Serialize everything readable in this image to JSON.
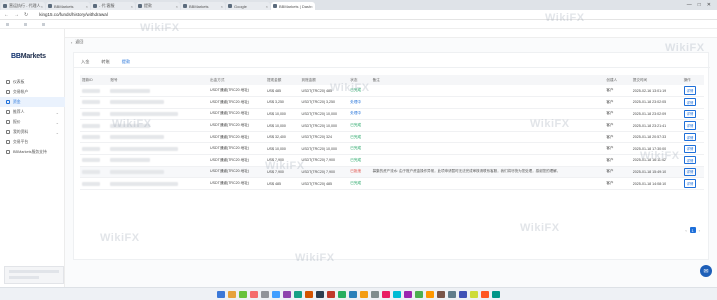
{
  "browser": {
    "tabs": [
      {
        "label": "营运执行 - 代理人"
      },
      {
        "label": "BBMarkets"
      },
      {
        "label": "- 代 客服"
      },
      {
        "label": "提款"
      },
      {
        "label": "BBMarkets"
      },
      {
        "label": "Google"
      },
      {
        "label": "BBMarkets | Dashboard"
      }
    ],
    "url": "king15.co/funds/history/withdrawal"
  },
  "sidebar": {
    "logo_prefix": "BB",
    "logo_suffix": "Markets",
    "items": [
      {
        "label": "仪表板"
      },
      {
        "label": "交易帐户"
      },
      {
        "label": "资金"
      },
      {
        "label": "推荐人"
      },
      {
        "label": "报价"
      },
      {
        "label": "我的资料"
      },
      {
        "label": "交易平台"
      },
      {
        "label": "BBMarkets服务支持"
      }
    ]
  },
  "main": {
    "back_label": "返回",
    "tabs": [
      {
        "label": "入金"
      },
      {
        "label": "转账"
      },
      {
        "label": "提款"
      }
    ],
    "columns": [
      "提款ID",
      "账号",
      "出金方式",
      "提现金额",
      "到账金额",
      "状态",
      "备注",
      "创建人",
      "提交时间",
      "操作"
    ],
    "rows": [
      {
        "method": "USDT通道(TRC20 地址)",
        "amount": "US$ 485",
        "received": "USDT(TRC20) 485",
        "status": "已完成",
        "status_class": "ok",
        "note": "",
        "creator": "客户",
        "time": "2025-02-16 13:01:19",
        "action": "详情"
      },
      {
        "method": "USDT通道(TRC20 地址)",
        "amount": "US$ 3,250",
        "received": "USDT(TRC20) 3,250",
        "status": "处理中",
        "status_class": "proc",
        "note": "",
        "creator": "客户",
        "time": "2025-01-18 23:02:05",
        "action": "详情"
      },
      {
        "method": "USDT通道(TRC20 地址)",
        "amount": "US$ 10,000",
        "received": "USDT(TRC20) 10,000",
        "status": "处理中",
        "status_class": "proc",
        "note": "",
        "creator": "客户",
        "time": "2025-01-18 23:02:09",
        "action": "详情"
      },
      {
        "method": "USDT通道(TRC20 地址)",
        "amount": "US$ 10,000",
        "received": "USDT(TRC20) 10,000",
        "status": "已完成",
        "status_class": "ok",
        "note": "",
        "creator": "客户",
        "time": "2025-01-18 23:21:41",
        "action": "详情"
      },
      {
        "method": "USDT通道(TRC20 地址)",
        "amount": "US$ 32,400",
        "received": "USDT(TRC20) 324",
        "status": "已完成",
        "status_class": "ok",
        "note": "",
        "creator": "客户",
        "time": "2025-01-18 20:57:33",
        "action": "详情"
      },
      {
        "method": "USDT通道(TRC20 地址)",
        "amount": "US$ 10,000",
        "received": "USDT(TRC20) 10,000",
        "status": "已完成",
        "status_class": "ok",
        "note": "",
        "creator": "客户",
        "time": "2025-01-18 17:30:00",
        "action": "详情"
      },
      {
        "method": "USDT通道(TRC20 地址)",
        "amount": "US$ 7,900",
        "received": "USDT(TRC20) 7,900",
        "status": "已完成",
        "status_class": "ok",
        "note": "",
        "creator": "客户",
        "time": "2025-01-18 16:11:42",
        "action": "详情"
      },
      {
        "method": "USDT通道(TRC20 地址)",
        "amount": "US$ 7,900",
        "received": "USDT(TRC20) 7,900",
        "status": "已拒绝",
        "status_class": "fail",
        "note": "募集的资产流水: 由于账户资金操作异常，此项申请暂时无法完成审核请联系客服，我们将尽快为您处理，感谢您的理解。",
        "creator": "客户",
        "time": "2025-01-18 15:49:10",
        "action": "详情"
      },
      {
        "method": "USDT通道(TRC20 地址)",
        "amount": "US$ 485",
        "received": "USDT(TRC20) 485",
        "status": "已完成",
        "status_class": "ok",
        "note": "",
        "creator": "客户",
        "time": "2025-01-18 14:08:10",
        "action": "详情"
      }
    ],
    "pagination": {
      "current": "1",
      "prev": "‹",
      "next": "›"
    }
  },
  "watermark": "WikiFX"
}
